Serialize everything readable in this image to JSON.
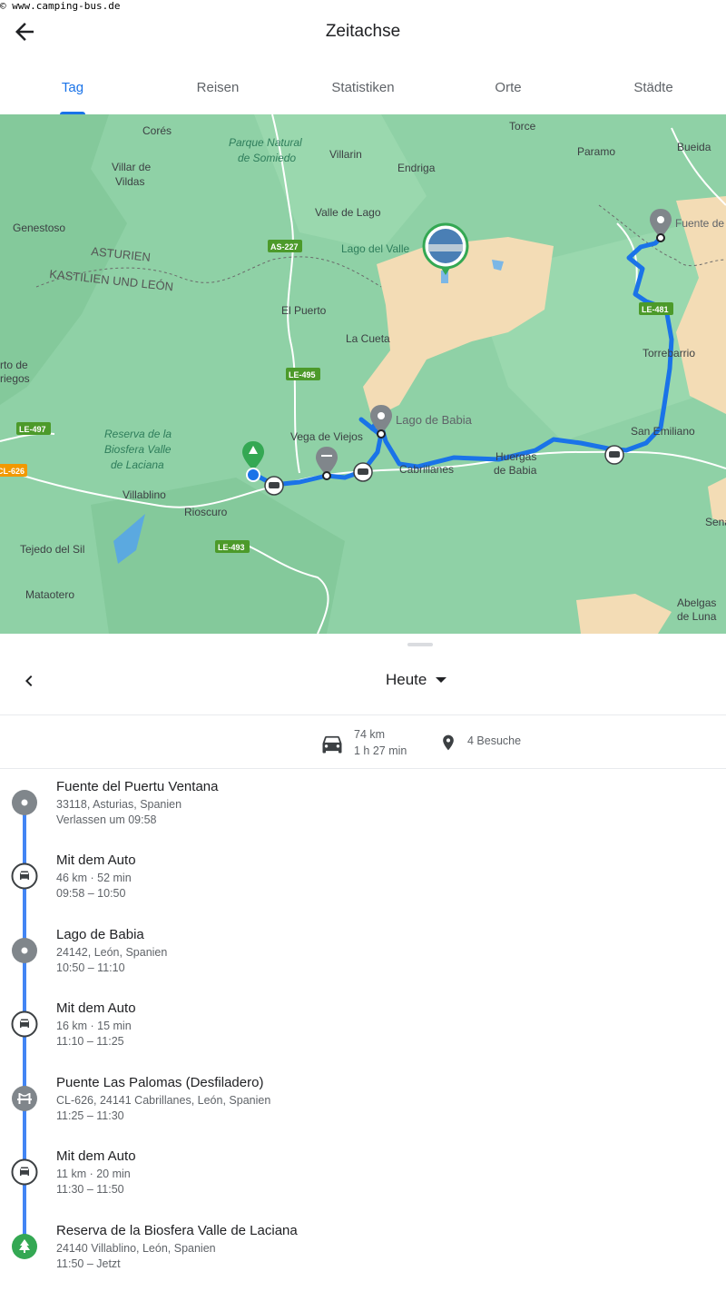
{
  "watermark": "© www.camping-bus.de",
  "app": {
    "title": "Zeitachse"
  },
  "tabs": [
    {
      "label": "Tag",
      "active": true
    },
    {
      "label": "Reisen",
      "active": false
    },
    {
      "label": "Statistiken",
      "active": false
    },
    {
      "label": "Orte",
      "active": false
    },
    {
      "label": "Städte",
      "active": false
    }
  ],
  "map": {
    "places": [
      "Corés",
      "Parque Natural",
      "de Somiedo",
      "Villarin",
      "Endriga",
      "Torce",
      "Paramo",
      "Bueida",
      "Villar de",
      "Vildas",
      "Genestoso",
      "ASTURIEN",
      "KASTILIEN UND LEÓN",
      "Valle de Lago",
      "Lago del Valle",
      "El Puerto",
      "La Cueta",
      "Torrebarrio",
      "Fuente de",
      "rto de",
      "riegos",
      "Reserva de la",
      "Biosfera Valle",
      "de Laciana",
      "Vega de Viejos",
      "Lago de Babia",
      "Huergas",
      "de Babia",
      "Cabrillanes",
      "San Emiliano",
      "Villablino",
      "Rioscuro",
      "Tejedo del Sil",
      "Mataotero",
      "Abelgas",
      "de Luna",
      "Sena"
    ],
    "roads": [
      "AS-227",
      "LE-495",
      "LE-497",
      "CL-626",
      "LE-481",
      "LE-493"
    ]
  },
  "day": {
    "label": "Heute"
  },
  "summary": {
    "distance": "74 km",
    "duration": "1 h 27 min",
    "visits": "4 Besuche"
  },
  "timeline": [
    {
      "kind": "place",
      "icon": "place-dot-icon",
      "title": "Fuente del Puertu Ventana",
      "line1": "33118, Asturias, Spanien",
      "line2": "Verlassen um 09:58"
    },
    {
      "kind": "drive",
      "icon": "car-icon",
      "title": "Mit dem Auto",
      "line1": "46 km · 52 min",
      "line2": "09:58 – 10:50"
    },
    {
      "kind": "place",
      "icon": "place-dot-icon",
      "title": "Lago de Babia",
      "line1": "24142, León, Spanien",
      "line2": "10:50 – 11:10"
    },
    {
      "kind": "drive",
      "icon": "car-icon",
      "title": "Mit dem Auto",
      "line1": "16 km · 15 min",
      "line2": "11:10 – 11:25"
    },
    {
      "kind": "place",
      "icon": "bridge-icon",
      "title": "Puente Las Palomas (Desfiladero)",
      "line1": "CL-626, 24141 Cabrillanes, León, Spanien",
      "line2": "11:25 – 11:30"
    },
    {
      "kind": "drive",
      "icon": "car-icon",
      "title": "Mit dem Auto",
      "line1": "11 km · 20 min",
      "line2": "11:30 – 11:50"
    },
    {
      "kind": "place",
      "icon": "tree-icon",
      "title": "Reserva de la Biosfera Valle de Laciana",
      "line1": "24140 Villablino, León, Spanien",
      "line2": "11:50 – Jetzt"
    }
  ],
  "colors": {
    "accent": "#1a73e8",
    "route": "#1a73e8",
    "place": "#80868b",
    "park": "#34a853",
    "map_green": "#8fd1a6",
    "map_sand": "#f3dcb5"
  }
}
